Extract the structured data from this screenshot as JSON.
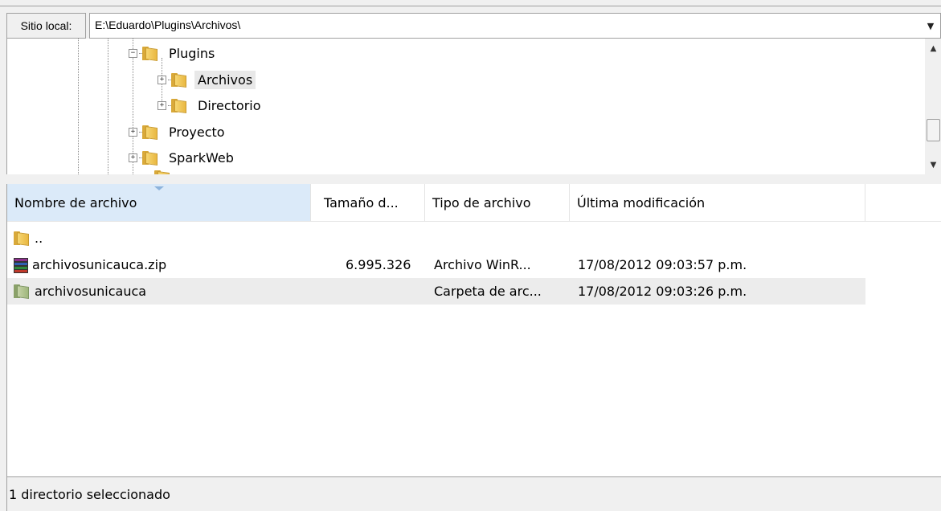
{
  "local_site": {
    "label": "Sitio local:",
    "path": "E:\\Eduardo\\Plugins\\Archivos\\"
  },
  "tree": {
    "nodes": [
      {
        "name": "Plugins",
        "expander": "−"
      },
      {
        "name": "Archivos",
        "expander": "+",
        "selected": true
      },
      {
        "name": "Directorio",
        "expander": "+"
      },
      {
        "name": "Proyecto",
        "expander": "+"
      },
      {
        "name": "SparkWeb",
        "expander": "+"
      }
    ]
  },
  "file_list": {
    "columns": [
      "Nombre de archivo",
      "Tamaño d...",
      "Tipo de archivo",
      "Última modificación"
    ],
    "sorted_column": "Nombre de archivo",
    "rows": [
      {
        "name": "..",
        "size": "",
        "type": "",
        "modified": "",
        "icon": "folder-icon"
      },
      {
        "name": "archivosunicauca.zip",
        "size": "6.995.326",
        "type": "Archivo WinR...",
        "modified": "17/08/2012 09:03:57 p.m.",
        "icon": "winrar-archive-icon"
      },
      {
        "name": "archivosunicauca",
        "size": "",
        "type": "Carpeta de arc...",
        "modified": "17/08/2012 09:03:26 p.m.",
        "icon": "compressed-folder-icon",
        "selected": true
      }
    ]
  },
  "status": {
    "text": "1 directorio seleccionado"
  },
  "colors": {
    "folder": "#f0c850",
    "compressed_folder": "#9fb67c",
    "sort_header": "#dbeaf9",
    "selection": "#ececec"
  }
}
